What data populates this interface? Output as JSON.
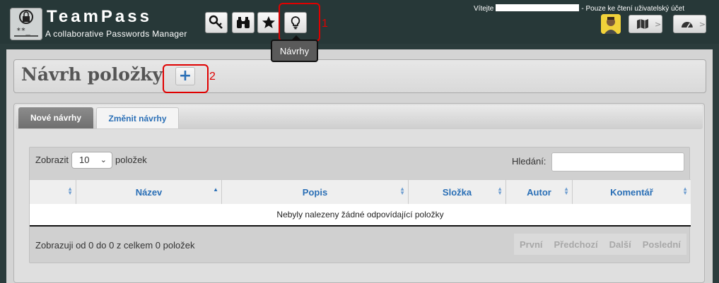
{
  "header": {
    "app_title": "TeamPass",
    "app_subtitle": "A collaborative Passwords Manager",
    "logo_icon": "lock-keypad-icon",
    "toolbar": [
      {
        "name": "key-icon"
      },
      {
        "name": "binoculars-icon"
      },
      {
        "name": "star-icon"
      },
      {
        "name": "lightbulb-icon"
      }
    ],
    "welcome_prefix": "Vítejte",
    "welcome_suffix": "- Pouze ke čtení uživatelský účet"
  },
  "tooltip": {
    "label": "Návrhy"
  },
  "annotations": {
    "one": "1",
    "two": "2",
    "accent": "#e00000"
  },
  "page": {
    "title": "Návrh položky",
    "add_symbol": "+"
  },
  "tabs": [
    {
      "label": "Nové návrhy",
      "active": true
    },
    {
      "label": "Změnit návrhy",
      "active": false
    }
  ],
  "table": {
    "length_label": "Zobrazit",
    "length_value": "10",
    "length_suffix": "položek",
    "search_label": "Hledání:",
    "columns": [
      "",
      "Název",
      "Popis",
      "Složka",
      "Autor",
      "Komentář"
    ],
    "empty_message": "Nebyly nalezeny žádné odpovídající položky",
    "info": "Zobrazuji od 0 do 0 z celkem 0 položek",
    "paging": [
      "První",
      "Předchozí",
      "Další",
      "Poslední"
    ]
  },
  "colors": {
    "link": "#2a6fb6",
    "header_bg": "#273838",
    "tab_active": "#7a7a7a"
  }
}
